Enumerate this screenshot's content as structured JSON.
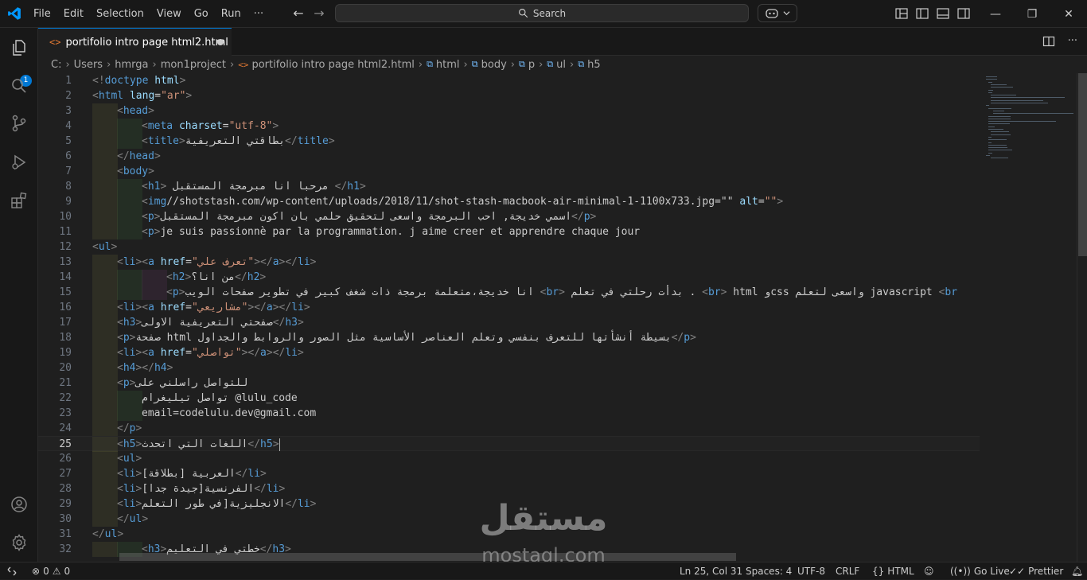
{
  "menubar": {
    "items": [
      "File",
      "Edit",
      "Selection",
      "View",
      "Go",
      "Run",
      "···"
    ]
  },
  "search": {
    "label": "Search"
  },
  "tab": {
    "title": "portifolio intro page html2.html",
    "icon": "html-file-icon",
    "dirty": true
  },
  "breadcrumb": {
    "items": [
      "C:",
      "Users",
      "hmrga",
      "mon1project",
      "portifolio intro page html2.html",
      "html",
      "body",
      "p",
      "ul",
      "h5"
    ]
  },
  "activitybar": {
    "source_control_badge": "1"
  },
  "editor": {
    "active_line": 25,
    "lines": [
      {
        "n": "1",
        "d": 0,
        "s": [
          [
            "b",
            "<!"
          ],
          [
            "t",
            "doctype"
          ],
          [
            "x",
            " "
          ],
          [
            "a",
            "html"
          ],
          [
            "b",
            ">"
          ]
        ]
      },
      {
        "n": "2",
        "d": 0,
        "s": [
          [
            "b",
            "<"
          ],
          [
            "t",
            "html"
          ],
          [
            "x",
            " "
          ],
          [
            "a",
            "lang"
          ],
          [
            "x",
            "="
          ],
          [
            "s",
            "\"ar\""
          ],
          [
            "b",
            ">"
          ]
        ]
      },
      {
        "n": "3",
        "d": 1,
        "s": [
          [
            "b",
            "<"
          ],
          [
            "t",
            "head"
          ],
          [
            "b",
            ">"
          ]
        ]
      },
      {
        "n": "4",
        "d": 2,
        "s": [
          [
            "b",
            "<"
          ],
          [
            "t",
            "meta"
          ],
          [
            "x",
            " "
          ],
          [
            "a",
            "charset"
          ],
          [
            "x",
            "="
          ],
          [
            "s",
            "\"utf-8\""
          ],
          [
            "b",
            ">"
          ]
        ]
      },
      {
        "n": "5",
        "d": 2,
        "s": [
          [
            "b",
            "<"
          ],
          [
            "t",
            "title"
          ],
          [
            "b",
            ">"
          ],
          [
            "x",
            "بطاقتي التعريفية"
          ],
          [
            "b",
            "</"
          ],
          [
            "t",
            "title"
          ],
          [
            "b",
            ">"
          ]
        ]
      },
      {
        "n": "6",
        "d": 1,
        "s": [
          [
            "b",
            "</"
          ],
          [
            "t",
            "head"
          ],
          [
            "b",
            ">"
          ]
        ]
      },
      {
        "n": "7",
        "d": 1,
        "s": [
          [
            "b",
            "<"
          ],
          [
            "t",
            "body"
          ],
          [
            "b",
            ">"
          ]
        ]
      },
      {
        "n": "8",
        "d": 2,
        "s": [
          [
            "b",
            "<"
          ],
          [
            "t",
            "h1"
          ],
          [
            "b",
            ">"
          ],
          [
            "x",
            " مرحبا انا مبرمجة المستقبل "
          ],
          [
            "b",
            "</"
          ],
          [
            "t",
            "h1"
          ],
          [
            "b",
            ">"
          ]
        ]
      },
      {
        "n": "9",
        "d": 2,
        "s": [
          [
            "b",
            "<"
          ],
          [
            "t",
            "img"
          ],
          [
            "x",
            "//shotstash.com/wp-content/uploads/2018/11/shot-stash-macbook-air-minimal-1-1100x733.jpg=\"\" "
          ],
          [
            "a",
            "alt"
          ],
          [
            "x",
            "="
          ],
          [
            "s",
            "\"\""
          ],
          [
            "b",
            ">"
          ]
        ]
      },
      {
        "n": "10",
        "d": 2,
        "s": [
          [
            "b",
            "<"
          ],
          [
            "t",
            "p"
          ],
          [
            "b",
            ">"
          ],
          [
            "x",
            "اسمي خديجة, احب البرمجة واسعى لتحقيق حلمي بان اكون مبرمجة المستقبل"
          ],
          [
            "b",
            "</"
          ],
          [
            "t",
            "p"
          ],
          [
            "b",
            ">"
          ]
        ]
      },
      {
        "n": "11",
        "d": 2,
        "s": [
          [
            "b",
            "<"
          ],
          [
            "t",
            "p"
          ],
          [
            "b",
            ">"
          ],
          [
            "x",
            "je suis passionnè par la programmation. j aime creer et apprendre chaque jour"
          ]
        ]
      },
      {
        "n": "12",
        "d": 0,
        "s": [
          [
            "b",
            "<"
          ],
          [
            "t",
            "ul"
          ],
          [
            "b",
            ">"
          ]
        ]
      },
      {
        "n": "13",
        "d": 1,
        "s": [
          [
            "b",
            "<"
          ],
          [
            "t",
            "li"
          ],
          [
            "b",
            "><"
          ],
          [
            "t",
            "a"
          ],
          [
            "x",
            " "
          ],
          [
            "a",
            "href"
          ],
          [
            "x",
            "="
          ],
          [
            "s",
            "\"تعرف علي\""
          ],
          [
            "b",
            "></"
          ],
          [
            "t",
            "a"
          ],
          [
            "b",
            "></"
          ],
          [
            "t",
            "li"
          ],
          [
            "b",
            ">"
          ]
        ]
      },
      {
        "n": "14",
        "d": 3,
        "s": [
          [
            "b",
            "<"
          ],
          [
            "t",
            "h2"
          ],
          [
            "b",
            ">"
          ],
          [
            "x",
            "من انا؟"
          ],
          [
            "b",
            "</"
          ],
          [
            "t",
            "h2"
          ],
          [
            "b",
            ">"
          ]
        ]
      },
      {
        "n": "15",
        "d": 3,
        "s": [
          [
            "b",
            "<"
          ],
          [
            "t",
            "p"
          ],
          [
            "b",
            ">"
          ],
          [
            "x",
            "انا خديجة،متعلمة برمجة ذات شغف كبير في تطوير صفحات الويب "
          ],
          [
            "b",
            "<"
          ],
          [
            "t",
            "br"
          ],
          [
            "b",
            ">"
          ],
          [
            "x",
            " بدأت رحلتي في تعلم . "
          ],
          [
            "b",
            "<"
          ],
          [
            "t",
            "br"
          ],
          [
            "b",
            ">"
          ],
          [
            "x",
            " html وcss واسعى لتعلم javascript "
          ],
          [
            "b",
            "<"
          ],
          [
            "t",
            "br"
          ]
        ]
      },
      {
        "n": "16",
        "d": 1,
        "s": [
          [
            "b",
            "<"
          ],
          [
            "t",
            "li"
          ],
          [
            "b",
            "><"
          ],
          [
            "t",
            "a"
          ],
          [
            "x",
            " "
          ],
          [
            "a",
            "href"
          ],
          [
            "x",
            "="
          ],
          [
            "s",
            "\"مشاريعي\""
          ],
          [
            "b",
            "></"
          ],
          [
            "t",
            "a"
          ],
          [
            "b",
            "></"
          ],
          [
            "t",
            "li"
          ],
          [
            "b",
            ">"
          ]
        ]
      },
      {
        "n": "17",
        "d": 1,
        "s": [
          [
            "b",
            "<"
          ],
          [
            "t",
            "h3"
          ],
          [
            "b",
            ">"
          ],
          [
            "x",
            "صفحتي التعريفية الاولى"
          ],
          [
            "b",
            "</"
          ],
          [
            "t",
            "h3"
          ],
          [
            "b",
            ">"
          ]
        ]
      },
      {
        "n": "18",
        "d": 1,
        "s": [
          [
            "b",
            "<"
          ],
          [
            "t",
            "p"
          ],
          [
            "b",
            ">"
          ],
          [
            "x",
            "صفحة html بسيطة أنشأتها للتعرف بنفسي وتعلم العناصر الأساسية مثل الصور والروابط والجداول"
          ],
          [
            "b",
            "</"
          ],
          [
            "t",
            "p"
          ],
          [
            "b",
            ">"
          ]
        ]
      },
      {
        "n": "19",
        "d": 1,
        "s": [
          [
            "b",
            "<"
          ],
          [
            "t",
            "li"
          ],
          [
            "b",
            "><"
          ],
          [
            "t",
            "a"
          ],
          [
            "x",
            " "
          ],
          [
            "a",
            "href"
          ],
          [
            "x",
            "="
          ],
          [
            "s",
            "\"تواصلي\""
          ],
          [
            "b",
            "></"
          ],
          [
            "t",
            "a"
          ],
          [
            "b",
            "></"
          ],
          [
            "t",
            "li"
          ],
          [
            "b",
            ">"
          ]
        ]
      },
      {
        "n": "20",
        "d": 1,
        "s": [
          [
            "b",
            "<"
          ],
          [
            "t",
            "h4"
          ],
          [
            "b",
            "></"
          ],
          [
            "t",
            "h4"
          ],
          [
            "b",
            ">"
          ]
        ]
      },
      {
        "n": "21",
        "d": 1,
        "s": [
          [
            "b",
            "<"
          ],
          [
            "t",
            "p"
          ],
          [
            "b",
            ">"
          ],
          [
            "x",
            "للتواصل راسلني على"
          ]
        ]
      },
      {
        "n": "22",
        "d": 2,
        "s": [
          [
            "x",
            "تواصل تيليغرام @lulu_code"
          ]
        ]
      },
      {
        "n": "23",
        "d": 2,
        "s": [
          [
            "x",
            "email=codelulu.dev@gmail.com"
          ]
        ]
      },
      {
        "n": "24",
        "d": 1,
        "s": [
          [
            "b",
            "</"
          ],
          [
            "t",
            "p"
          ],
          [
            "b",
            ">"
          ]
        ]
      },
      {
        "n": "25",
        "d": 1,
        "s": [
          [
            "b",
            "<"
          ],
          [
            "t",
            "h5"
          ],
          [
            "b",
            ">"
          ],
          [
            "x",
            "اللغات التي اتحدث"
          ],
          [
            "b",
            "</"
          ],
          [
            "t",
            "h5"
          ],
          [
            "b",
            ">"
          ]
        ]
      },
      {
        "n": "26",
        "d": 1,
        "s": [
          [
            "b",
            "<"
          ],
          [
            "t",
            "ul"
          ],
          [
            "b",
            ">"
          ]
        ]
      },
      {
        "n": "27",
        "d": 1,
        "s": [
          [
            "b",
            "<"
          ],
          [
            "t",
            "li"
          ],
          [
            "b",
            ">"
          ],
          [
            "x",
            "العربية [بطلاقة]"
          ],
          [
            "b",
            "</"
          ],
          [
            "t",
            "li"
          ],
          [
            "b",
            ">"
          ]
        ]
      },
      {
        "n": "28",
        "d": 1,
        "s": [
          [
            "b",
            "<"
          ],
          [
            "t",
            "li"
          ],
          [
            "b",
            ">"
          ],
          [
            "x",
            "الفرنسية[جيدة جدا]"
          ],
          [
            "b",
            "</"
          ],
          [
            "t",
            "li"
          ],
          [
            "b",
            ">"
          ]
        ]
      },
      {
        "n": "29",
        "d": 1,
        "s": [
          [
            "b",
            "<"
          ],
          [
            "t",
            "li"
          ],
          [
            "b",
            ">"
          ],
          [
            "x",
            "الانجليزية[في طور التعلم"
          ],
          [
            "b",
            "</"
          ],
          [
            "t",
            "li"
          ],
          [
            "b",
            ">"
          ]
        ]
      },
      {
        "n": "30",
        "d": 1,
        "s": [
          [
            "b",
            "</"
          ],
          [
            "t",
            "ul"
          ],
          [
            "b",
            ">"
          ]
        ]
      },
      {
        "n": "31",
        "d": 0,
        "s": [
          [
            "b",
            "</"
          ],
          [
            "t",
            "ul"
          ],
          [
            "b",
            ">"
          ]
        ]
      },
      {
        "n": "32",
        "d": 2,
        "s": [
          [
            "b",
            "<"
          ],
          [
            "t",
            "h3"
          ],
          [
            "b",
            ">"
          ],
          [
            "x",
            "خطتي في التعليم"
          ],
          [
            "b",
            "</"
          ],
          [
            "t",
            "h3"
          ],
          [
            "b",
            ">"
          ]
        ]
      }
    ]
  },
  "statusbar": {
    "errors": "0",
    "warnings": "0",
    "position": "Ln 25, Col 31",
    "spaces": "Spaces: 4",
    "encoding": "UTF-8",
    "eol": "CRLF",
    "language": "HTML",
    "golive": "Go Live",
    "prettier": "Prettier"
  },
  "watermark": {
    "arabic": "مستقل",
    "latin": "mostaql.com"
  },
  "colors": {
    "accent": "#0078d4",
    "tag": "#569cd6",
    "attribute": "#9cdcfe",
    "string": "#ce9178",
    "bracket": "#808080",
    "text": "#cccccc",
    "html_icon": "#e37933"
  }
}
